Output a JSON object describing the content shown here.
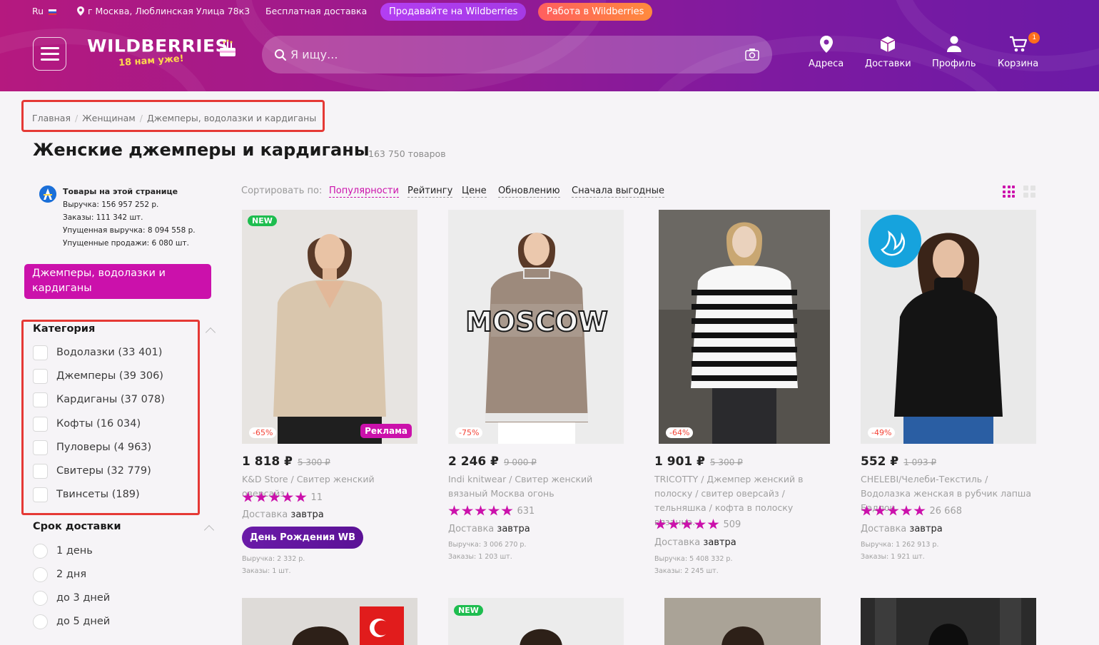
{
  "topbar": {
    "lang": "Ru",
    "address": "г Москва, Люблинская Улица 78к3",
    "free_delivery": "Бесплатная доставка",
    "sell_label": "Продавайте на Wildberries",
    "work_label": "Работа в Wildberries"
  },
  "logo": {
    "brand": "WILDBERRIES",
    "tagline": "18 нам уже!"
  },
  "search": {
    "placeholder": "Я ищу..."
  },
  "nav": {
    "addresses": "Адреса",
    "deliveries": "Доставки",
    "profile": "Профиль",
    "cart": "Корзина",
    "cart_count": "1"
  },
  "breadcrumbs": [
    "Главная",
    "Женщинам",
    "Джемперы, водолазки и кардиганы"
  ],
  "page": {
    "title": "Женские джемперы и кардиганы",
    "count": "163 750 товаров"
  },
  "stats": {
    "heading": "Товары на этой странице",
    "revenue": "Выручка: 156 957 252 р.",
    "orders": "Заказы: 111 342 шт.",
    "lost_revenue": "Упущенная выручка: 8 094 558 р.",
    "lost_sales": "Упущенные продажи: 6 080 шт."
  },
  "active_category": "Джемперы, водолазки и кардиганы",
  "filters": {
    "category": {
      "title": "Категория",
      "items": [
        "Водолазки (33 401)",
        "Джемперы (39 306)",
        "Кардиганы (37 078)",
        "Кофты (16 034)",
        "Пуловеры (4 963)",
        "Свитеры (32 779)",
        "Твинсеты (189)"
      ]
    },
    "delivery": {
      "title": "Срок доставки",
      "items": [
        "1 день",
        "2 дня",
        "до 3 дней",
        "до 5 дней"
      ]
    }
  },
  "sort": {
    "label": "Сортировать по:",
    "options": [
      "Популярности",
      "Рейтингу",
      "Цене",
      "Обновлению",
      "Сначала выгодные"
    ],
    "active": "Популярности"
  },
  "colors": {
    "accent": "#cb11ab",
    "discount": "#f44336",
    "new": "#1ebd4f",
    "promo": "#5f0fa0"
  },
  "products": [
    {
      "badge_new": "NEW",
      "discount": "-65%",
      "ad": "Реклама",
      "price": "1 818 ₽",
      "old_price": "5 300 ₽",
      "name": "K&D Store / Свитер женский оверсайз",
      "stars": 5,
      "reviews": "11",
      "delivery_label": "Доставка",
      "delivery_when": "завтра",
      "promo": "День Рождения WB",
      "revenue": "Выручка: 2 332 р.",
      "orders": "Заказы: 1 шт."
    },
    {
      "discount": "-75%",
      "price": "2 246 ₽",
      "old_price": "9 000 ₽",
      "name": "Indi knitwear / Свитер женский вязаный Москва огонь",
      "stars": 5,
      "reviews": "631",
      "delivery_label": "Доставка",
      "delivery_when": "завтра",
      "revenue": "Выручка: 3 006 270 р.",
      "orders": "Заказы: 1 203 шт.",
      "print_text": "MOSCOW"
    },
    {
      "discount": "-64%",
      "price": "1 901 ₽",
      "old_price": "5 300 ₽",
      "name": "TRICOTTY / Джемпер женский в полоску / свитер оверсайз / тельняшка / кофта в полоску вязанна...",
      "stars": 5,
      "reviews": "509",
      "delivery_label": "Доставка",
      "delivery_when": "завтра",
      "revenue": "Выручка: 5 408 332 р.",
      "orders": "Заказы: 2 245 шт."
    },
    {
      "discount": "-49%",
      "price": "552 ₽",
      "old_price": "1 093 ₽",
      "name": "CHELEBI/Челеби-Текстиль / Водолазка женская в рубчик лапша Бадлон",
      "stars": 5,
      "reviews": "26 668",
      "delivery_label": "Доставка",
      "delivery_when": "завтра",
      "revenue": "Выручка: 1 262 913 р.",
      "orders": "Заказы: 1 921 шт."
    }
  ],
  "row2": {
    "badge_new": "NEW"
  }
}
